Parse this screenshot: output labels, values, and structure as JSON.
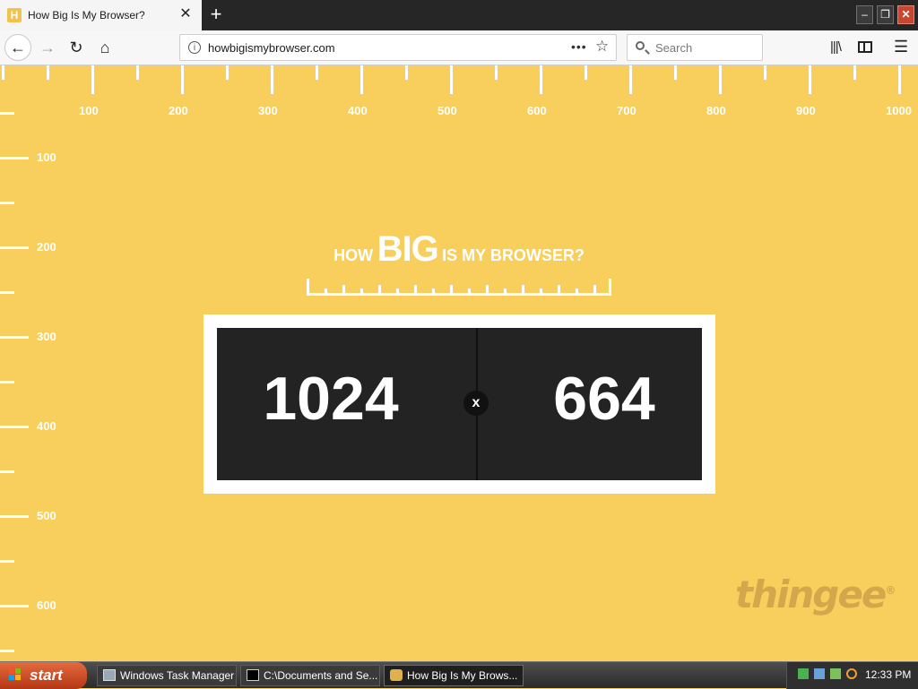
{
  "browser": {
    "tab": {
      "favicon_letter": "H",
      "title": "How Big Is My Browser?",
      "close_glyph": "✕"
    },
    "new_tab_glyph": "+",
    "window_buttons": {
      "minimize": "–",
      "maximize": "❐",
      "close": "✕"
    },
    "nav": {
      "back": "←",
      "forward": "→",
      "reload": "↻",
      "home": "⌂"
    },
    "url": "howbigismybrowser.com",
    "info_glyph": "i",
    "page_actions_glyph": "•••",
    "bookmark_glyph": "☆",
    "search": {
      "placeholder": "Search",
      "value": ""
    },
    "library_glyph": "|||\\",
    "menu_glyph": "☰"
  },
  "page": {
    "ruler_top_labels": [
      "100",
      "200",
      "300",
      "400",
      "500",
      "600",
      "700",
      "800",
      "900",
      "1000"
    ],
    "ruler_left_labels": [
      "100",
      "200",
      "300",
      "400",
      "500",
      "600"
    ],
    "headline": {
      "how": "HOW",
      "big": "BIG",
      "rest": "IS MY BROWSER?"
    },
    "width_value": "1024",
    "times": "x",
    "height_value": "664",
    "brand": "thingee",
    "brand_mark": "®",
    "background_color": "#f8cf5c"
  },
  "taskbar": {
    "start_label": "start",
    "items": [
      {
        "label": "Windows Task Manager",
        "icon": "task-manager-icon"
      },
      {
        "label": "C:\\Documents and Se...",
        "icon": "command-prompt-icon"
      },
      {
        "label": "How Big Is My Brows...",
        "icon": "browser-icon"
      }
    ],
    "clock": "12:33 PM"
  }
}
